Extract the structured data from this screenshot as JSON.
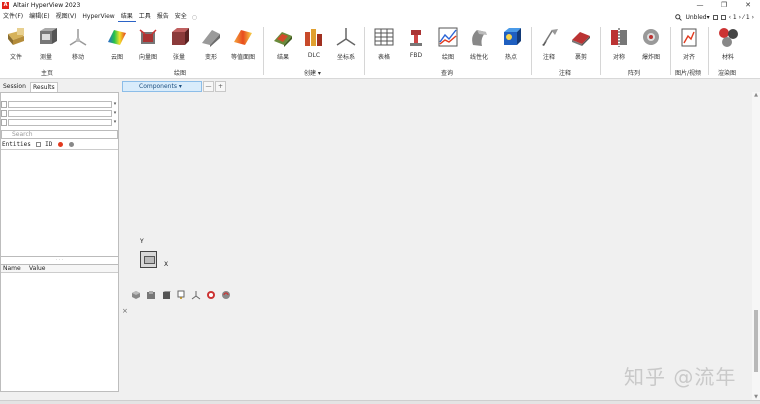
{
  "app": {
    "title": "Altair HyperView 2023",
    "logo_letter": "A"
  },
  "window_controls": {
    "minimize": "—",
    "maximize": "❐",
    "close": "✕"
  },
  "menu": {
    "items": [
      "文件(F)",
      "编辑(E)",
      "视图(V)",
      "HyperView",
      "结果",
      "工具",
      "报告",
      "安全"
    ],
    "active_index": 4,
    "extra": "○"
  },
  "menu_right": {
    "search_icon": "search-icon",
    "user": "Unbled▾",
    "page_indicator": "‹ 1 › ⁄ 1 ›"
  },
  "ribbon": {
    "tools": [
      {
        "label": "文件",
        "icon": "file-icon"
      },
      {
        "label": "测量",
        "icon": "measure-icon"
      },
      {
        "label": "移动",
        "icon": "move-icon"
      },
      {
        "label": "云图",
        "icon": "contour-icon"
      },
      {
        "label": "向量图",
        "icon": "vector-icon"
      },
      {
        "label": "张量",
        "icon": "tensor-icon"
      },
      {
        "label": "变形",
        "icon": "deform-icon"
      },
      {
        "label": "等值面图",
        "icon": "isosurface-icon"
      },
      {
        "label": "结果",
        "icon": "results-icon"
      },
      {
        "label": "DLC",
        "icon": "dlc-icon"
      },
      {
        "label": "坐标系",
        "icon": "coordinate-system-icon"
      },
      {
        "label": "表格",
        "icon": "table-icon"
      },
      {
        "label": "FBD",
        "icon": "fbd-icon"
      },
      {
        "label": "绘图",
        "icon": "plot-icon"
      },
      {
        "label": "线性化",
        "icon": "linearize-icon"
      },
      {
        "label": "热点",
        "icon": "hotspot-icon"
      },
      {
        "label": "注释",
        "icon": "note-icon"
      },
      {
        "label": "裹剪",
        "icon": "trim-icon"
      },
      {
        "label": "对称",
        "icon": "symmetry-icon"
      },
      {
        "label": "爆炸图",
        "icon": "explode-icon"
      },
      {
        "label": "对齐",
        "icon": "align-icon"
      },
      {
        "label": "材料",
        "icon": "material-icon"
      }
    ],
    "groups": [
      "主页",
      "绘图",
      "创建 ▾",
      "查询",
      "注释",
      "阵列",
      "图片/视频",
      "渲染图"
    ]
  },
  "subrow": {
    "tabs": [
      "Session",
      "Results"
    ],
    "active_tab": 1,
    "components_label": "Components ▾",
    "btn_a": "—",
    "btn_b": "+"
  },
  "panel": {
    "filter_dropdown": "▾",
    "search_placeholder": "Search",
    "entities_label": "Entities",
    "id_label": "ID",
    "splitter_glyph": "· · ·",
    "col_name": "Name",
    "col_value": "Value"
  },
  "graphics": {
    "axis_y": "Y",
    "axis_x": "X",
    "cross": "×",
    "view_tools": [
      "iso-view-icon",
      "fit-view-icon",
      "front-view-icon",
      "side-view-icon",
      "axis-view-icon",
      "zoom-view-icon",
      "rotate-view-icon"
    ]
  },
  "watermark": "知乎 @流年",
  "colors": {
    "accent": "#2b63c6",
    "components_tab_bg": "#d9ecfb",
    "logo": "#e2231a"
  }
}
